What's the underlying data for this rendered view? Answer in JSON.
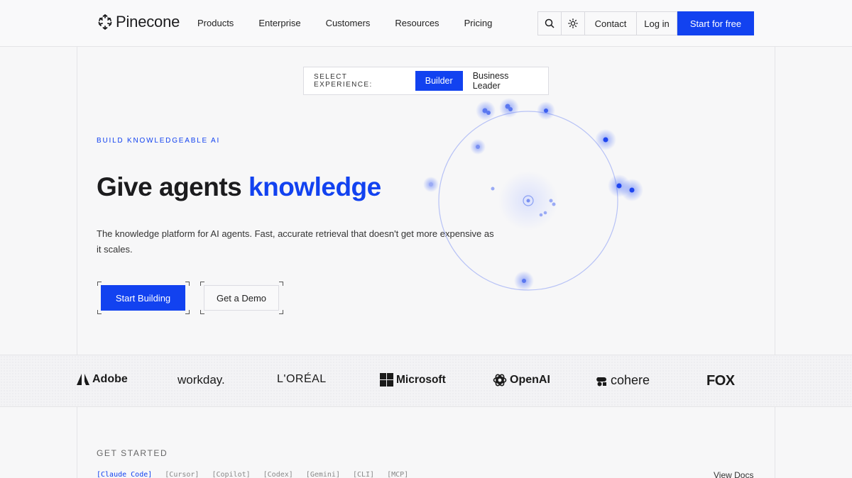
{
  "header": {
    "brand": "Pinecone",
    "nav": [
      "Products",
      "Enterprise",
      "Customers",
      "Resources",
      "Pricing"
    ],
    "search_icon": "search-icon",
    "theme_icon": "sun-icon",
    "contact": "Contact",
    "login": "Log in",
    "cta": "Start for free"
  },
  "selector": {
    "label": "SELECT EXPERIENCE:",
    "options": [
      "Builder",
      "Business Leader"
    ],
    "active": "Builder"
  },
  "hero": {
    "eyebrow": "BUILD KNOWLEDGEABLE AI",
    "headline_plain": "Give agents ",
    "headline_accent": "knowledge",
    "subtext": "The knowledge platform for AI agents. Fast, accurate retrieval that doesn't get more expensive as it scales.",
    "primary_cta": "Start Building",
    "secondary_cta": "Get a Demo"
  },
  "logos": [
    "Adobe",
    "workday.",
    "L'ORÉAL",
    "Microsoft",
    "OpenAI",
    "cohere",
    "FOX"
  ],
  "get_started": {
    "label": "GET STARTED",
    "tabs": [
      "[Claude Code]",
      "[Cursor]",
      "[Copilot]",
      "[Codex]",
      "[Gemini]",
      "[CLI]",
      "[MCP]"
    ],
    "view_docs": "View Docs"
  },
  "colors": {
    "accent": "#1242f0",
    "background": "#f7f7f8"
  }
}
